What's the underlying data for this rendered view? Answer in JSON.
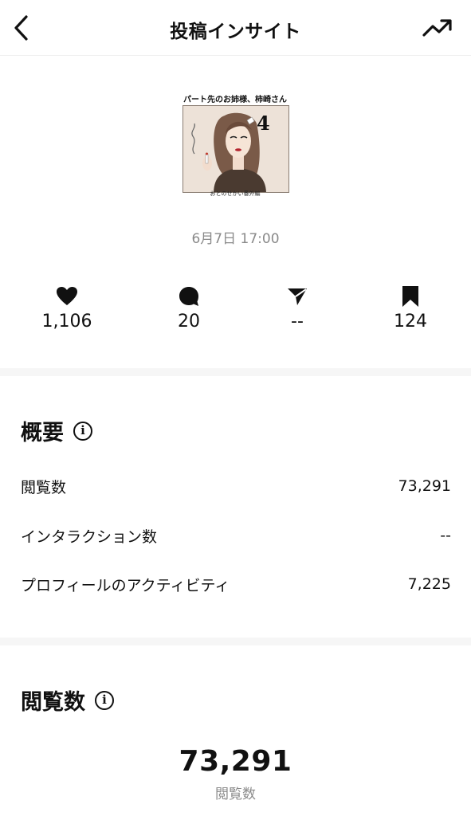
{
  "header": {
    "title": "投稿インサイト",
    "back_icon": "chevron-left-icon",
    "trend_icon": "trending-up-icon"
  },
  "post": {
    "thumbnail_title": "パート先のお姉様、柿崎さん",
    "thumbnail_number": "4",
    "thumbnail_caption": "おとのせかい番外編",
    "date": "6月7日 17:00"
  },
  "stats": [
    {
      "icon": "heart-icon",
      "value": "1,106"
    },
    {
      "icon": "comment-icon",
      "value": "20"
    },
    {
      "icon": "send-icon",
      "value": "--"
    },
    {
      "icon": "bookmark-icon",
      "value": "124"
    }
  ],
  "overview": {
    "title": "概要",
    "rows": [
      {
        "label": "閲覧数",
        "value": "73,291"
      },
      {
        "label": "インタラクション数",
        "value": "--"
      },
      {
        "label": "プロフィールのアクティビティ",
        "value": "7,225"
      }
    ]
  },
  "views": {
    "title": "閲覧数",
    "total": "73,291",
    "total_label": "閲覧数"
  },
  "colors": {
    "text": "#111111",
    "muted": "#8a8a8a",
    "divider": "#f6f6f6"
  }
}
